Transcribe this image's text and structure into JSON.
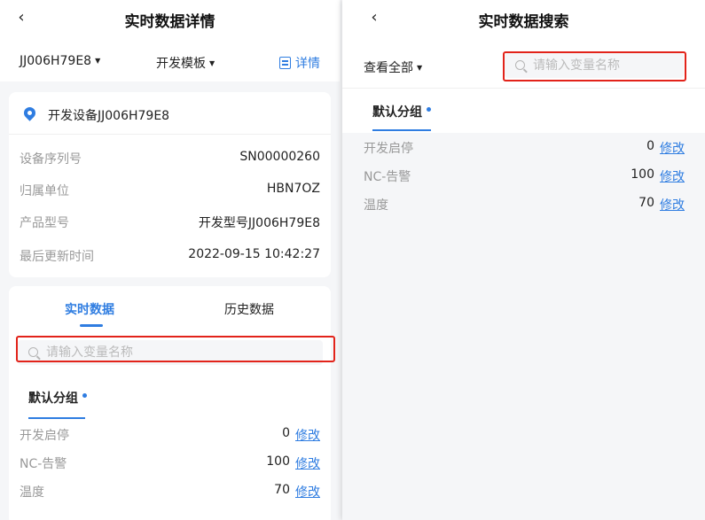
{
  "left": {
    "nav_title": "实时数据详情",
    "back_icon": "chevron-left-icon",
    "device_select": "JJ006H79E8",
    "template_select": "开发模板",
    "detail_link": "详情",
    "device": {
      "name": "开发设备JJ006H79E8",
      "rows": [
        {
          "label": "设备序列号",
          "value": "SN00000260"
        },
        {
          "label": "归属单位",
          "value": "HBN7OZ"
        },
        {
          "label": "产品型号",
          "value": "开发型号JJ006H79E8"
        },
        {
          "label": "最后更新时间",
          "value": "2022-09-15 10:42:27"
        }
      ]
    },
    "tabs": [
      "实时数据",
      "历史数据"
    ],
    "active_tab": "实时数据",
    "search_placeholder": "请输入变量名称",
    "group_tab": "默认分组",
    "variables": [
      {
        "name": "开发启停",
        "value": "0",
        "edit": "修改"
      },
      {
        "name": "NC-告警",
        "value": "100",
        "edit": "修改"
      },
      {
        "name": "温度",
        "value": "70",
        "edit": "修改"
      }
    ]
  },
  "right": {
    "nav_title": "实时数据搜索",
    "back_icon": "chevron-left-icon",
    "filter_select": "查看全部",
    "search_placeholder": "请输入变量名称",
    "group_tab": "默认分组",
    "variables": [
      {
        "name": "开发启停",
        "value": "0",
        "edit": "修改"
      },
      {
        "name": "NC-告警",
        "value": "100",
        "edit": "修改"
      },
      {
        "name": "温度",
        "value": "70",
        "edit": "修改"
      }
    ]
  },
  "colors": {
    "accent": "#2f7de1",
    "highlight_box": "#e2231a",
    "background": "#f5f6f8"
  }
}
